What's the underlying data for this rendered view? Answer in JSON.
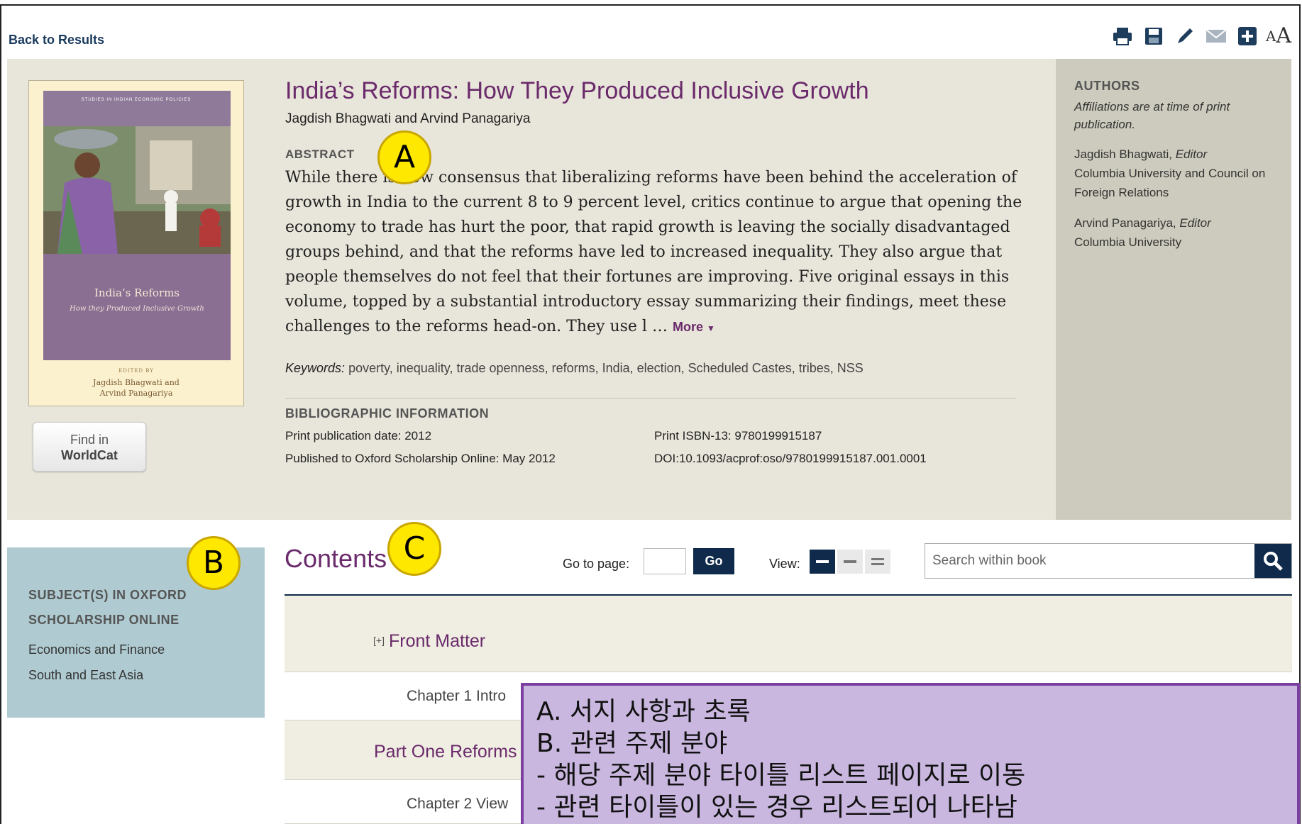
{
  "topbar": {
    "back_label": "Back to Results",
    "tools": [
      "print-icon",
      "save-icon",
      "pencil-icon",
      "email-icon",
      "add-icon"
    ],
    "font_size_small": "A",
    "font_size_large": "A"
  },
  "book": {
    "title": "India’s Reforms: How They Produced Inclusive Growth",
    "authors": "Jagdish Bhagwati and Arvind Panagariya",
    "abstract_heading": "ABSTRACT",
    "abstract_text": "While there is now consensus that liberalizing reforms have been behind the acceleration of growth in India to the current 8 to 9 percent level, critics continue to argue that opening the economy to trade has hurt the poor, that rapid growth is leaving the socially disadvantaged groups behind, and that the reforms have led to increased inequality. They also argue that people themselves do not feel that their fortunes are improving. Five original essays in this volume, topped by a substantial introductory essay summarizing their findings, meet these challenges to the reforms head-on. They use l …",
    "more_label": "More",
    "keywords_label": "Keywords:",
    "keywords": "poverty, inequality, trade openness, reforms, India, election, Scheduled Castes, tribes, NSS",
    "biblio_heading": "BIBLIOGRAPHIC INFORMATION",
    "print_date": "Print publication date: 2012",
    "online_date": "Published to Oxford Scholarship Online: May 2012",
    "isbn": "Print ISBN-13: 9780199915187",
    "doi": "DOI:10.1093/acprof:oso/9780199915187.001.0001"
  },
  "cover": {
    "series": "STUDIES IN INDIAN ECONOMIC POLICIES",
    "title": "India’s Reforms",
    "subtitle": "How they Produced Inclusive Growth",
    "edited_by": "EDITED BY",
    "authors_line1": "Jagdish Bhagwati and",
    "authors_line2": "Arvind Panagariya"
  },
  "worldcat": {
    "line1": "Find in",
    "line2": "WorldCat"
  },
  "authors_panel": {
    "heading": "AUTHORS",
    "note": "Affiliations are at time of print publication.",
    "people": [
      {
        "name": "Jagdish Bhagwati,",
        "role": "Editor",
        "affiliation": "Columbia University and Council on Foreign Relations"
      },
      {
        "name": "Arvind Panagariya,",
        "role": "Editor",
        "affiliation": "Columbia University"
      }
    ]
  },
  "subjects": {
    "heading_line1": "SUBJECT(S) IN OXFORD",
    "heading_line2": "SCHOLARSHIP ONLINE",
    "items": [
      "Economics and Finance",
      "South and East Asia"
    ]
  },
  "contents": {
    "title": "Contents",
    "goto_label": "Go to page:",
    "goto_value": "",
    "go_label": "Go",
    "view_label": "View:",
    "search_placeholder": "Search within book",
    "toc": [
      {
        "toggle": "[+]",
        "label": "Front Matter",
        "kind": "section"
      },
      {
        "label": "Chapter 1 Intro",
        "kind": "chapter"
      },
      {
        "label": "Part One Reforms",
        "kind": "part"
      },
      {
        "label": "Chapter 2 View",
        "kind": "chapter"
      }
    ]
  },
  "annotations": {
    "markers": [
      "A",
      "B",
      "C"
    ],
    "notes": [
      "A. 서지 사항과 초록",
      "B. 관련 주제 분야",
      " - 해당 주제 분야 타이틀 리스트 페이지로 이동",
      " - 관련 타이틀이 있는 경우 리스트되어 나타남"
    ]
  },
  "colors": {
    "title_purple": "#6a2a6b",
    "navy": "#0f2a4a",
    "info_bg": "#e8e5da",
    "subject_bg": "#afcbd1",
    "marker_yellow": "#ffe800",
    "note_bg": "#c9b7df"
  }
}
